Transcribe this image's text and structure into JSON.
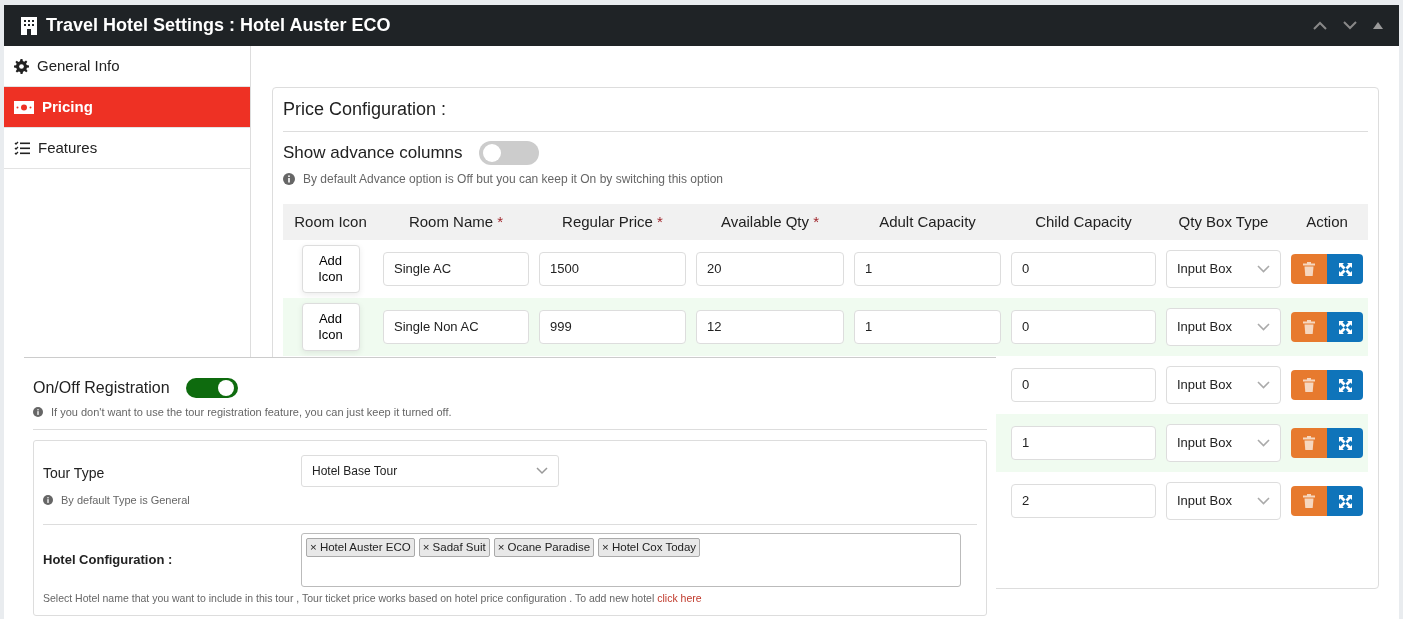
{
  "window": {
    "title": "Travel Hotel Settings : Hotel Auster ECO"
  },
  "sidebar": {
    "items": [
      {
        "label": "General Info",
        "selected": false
      },
      {
        "label": "Pricing",
        "selected": true
      },
      {
        "label": "Features",
        "selected": false
      }
    ]
  },
  "price_configuration": {
    "title": "Price Configuration :",
    "advance_columns": {
      "label": "Show advance columns",
      "on": false,
      "hint": "By default Advance option is Off but you can keep it On by switching this option"
    },
    "table": {
      "columns": [
        {
          "label": "Room Icon"
        },
        {
          "label": "Room Name",
          "required_mark": "*"
        },
        {
          "label": "Regular Price",
          "required_mark": "*"
        },
        {
          "label": "Available Qty",
          "required_mark": "*"
        },
        {
          "label": "Adult Capacity"
        },
        {
          "label": "Child Capacity"
        },
        {
          "label": "Qty Box Type"
        },
        {
          "label": "Action"
        }
      ],
      "rows": [
        {
          "room_icon": "Add Icon",
          "room_name": "Single AC",
          "regular_price": "1500",
          "available_qty": "20",
          "adult_capacity": "1",
          "child_capacity": "0",
          "qty_box_type": "Input Box"
        },
        {
          "room_icon": "Add Icon",
          "room_name": "Single Non AC",
          "regular_price": "999",
          "available_qty": "12",
          "adult_capacity": "1",
          "child_capacity": "0",
          "qty_box_type": "Input Box"
        },
        {
          "child_capacity": "0",
          "qty_box_type": "Input Box"
        },
        {
          "child_capacity": "1",
          "qty_box_type": "Input Box"
        },
        {
          "child_capacity": "2",
          "qty_box_type": "Input Box"
        }
      ]
    }
  },
  "registration": {
    "label": "On/Off Registration",
    "on": true,
    "hint": "If you don't want to use the tour registration feature, you can just keep it turned off.",
    "tour_type": {
      "label": "Tour Type",
      "value": "Hotel Base Tour",
      "hint": "By default Type is General"
    },
    "hotel_configuration": {
      "label": "Hotel Configuration :",
      "tags": [
        "× Hotel Auster ECO",
        "× Sadaf Suit",
        "× Ocane Paradise",
        "× Hotel Cox Today"
      ],
      "hint": "Select Hotel name that you want to include in this tour , Tour ticket price works based on hotel price configuration . To add new hotel ",
      "link": "click here"
    }
  }
}
